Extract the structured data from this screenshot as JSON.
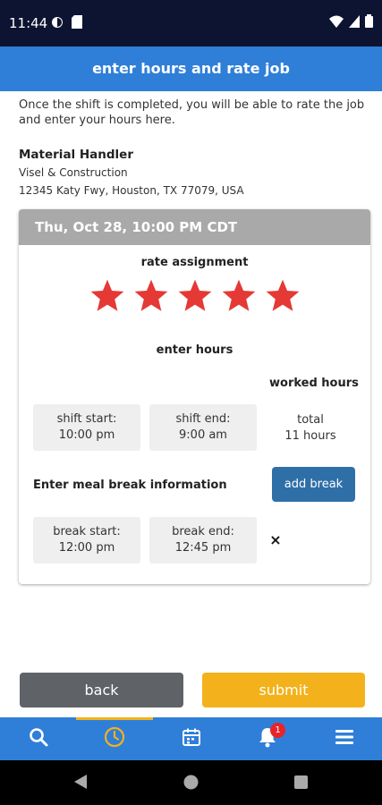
{
  "status_bar": {
    "time": "11:44"
  },
  "header": {
    "title": "enter hours and rate job"
  },
  "intro": "Once the shift is completed, you will be able to rate the job and enter your hours here.",
  "job": {
    "title": "Material Handler",
    "company": "Visel & Construction",
    "address": "12345 Katy Fwy, Houston, TX 77079, USA"
  },
  "card": {
    "date": "Thu, Oct 28, 10:00 PM CDT",
    "rate_label": "rate assignment",
    "rating": 5,
    "rating_max": 5,
    "enter_hours_label": "enter hours",
    "worked_hours_label": "worked hours",
    "shift_start_label": "shift start:",
    "shift_start_value": "10:00 pm",
    "shift_end_label": "shift end:",
    "shift_end_value": "9:00 am",
    "total_label": "total",
    "total_value": "11 hours",
    "meal_label": "Enter meal break information",
    "add_break_label": "add break",
    "break_start_label": "break start:",
    "break_start_value": "12:00 pm",
    "break_end_label": "break end:",
    "break_end_value": "12:45 pm",
    "remove_label": "×"
  },
  "actions": {
    "back_label": "back",
    "submit_label": "submit"
  },
  "nav": {
    "items": [
      "search-icon",
      "clock-icon",
      "calendar-icon",
      "bell-icon",
      "menu-icon"
    ],
    "active": "clock-icon",
    "notification_count": "1"
  },
  "colors": {
    "header": "#2f7fd8",
    "star": "#e53935",
    "submit": "#f3b21b",
    "back": "#5f6368",
    "add_break": "#2f6fa8"
  }
}
